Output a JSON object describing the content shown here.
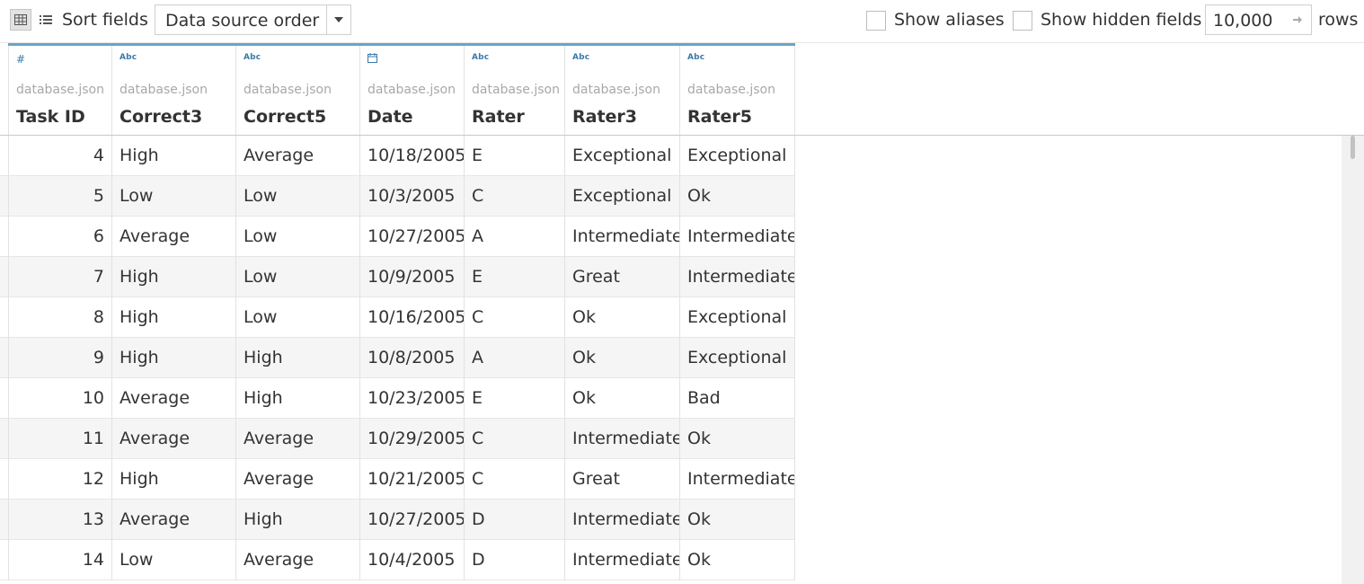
{
  "toolbar": {
    "sort_label": "Sort fields",
    "sort_value": "Data source order",
    "show_aliases_label": "Show aliases",
    "show_aliases_checked": false,
    "show_hidden_label": "Show hidden fields",
    "show_hidden_checked": false,
    "rows_value": "10,000",
    "rows_label": "rows",
    "grid_view_icon": "grid-icon",
    "list_view_icon": "list-icon"
  },
  "columns": [
    {
      "type_icon": "#",
      "type": "number",
      "source": "database.json",
      "name": "Task ID"
    },
    {
      "type_icon": "Abc",
      "type": "string",
      "source": "database.json",
      "name": "Correct3"
    },
    {
      "type_icon": "Abc",
      "type": "string",
      "source": "database.json",
      "name": "Correct5"
    },
    {
      "type_icon": "calendar",
      "type": "date",
      "source": "database.json",
      "name": "Date"
    },
    {
      "type_icon": "Abc",
      "type": "string",
      "source": "database.json",
      "name": "Rater"
    },
    {
      "type_icon": "Abc",
      "type": "string",
      "source": "database.json",
      "name": "Rater3"
    },
    {
      "type_icon": "Abc",
      "type": "string",
      "source": "database.json",
      "name": "Rater5"
    }
  ],
  "rows": [
    [
      "4",
      "High",
      "Average",
      "10/18/2005",
      "E",
      "Exceptional",
      "Exceptional"
    ],
    [
      "5",
      "Low",
      "Low",
      "10/3/2005",
      "C",
      "Exceptional",
      "Ok"
    ],
    [
      "6",
      "Average",
      "Low",
      "10/27/2005",
      "A",
      "Intermediate",
      "Intermediate"
    ],
    [
      "7",
      "High",
      "Low",
      "10/9/2005",
      "E",
      "Great",
      "Intermediate"
    ],
    [
      "8",
      "High",
      "Low",
      "10/16/2005",
      "C",
      "Ok",
      "Exceptional"
    ],
    [
      "9",
      "High",
      "High",
      "10/8/2005",
      "A",
      "Ok",
      "Exceptional"
    ],
    [
      "10",
      "Average",
      "High",
      "10/23/2005",
      "E",
      "Ok",
      "Bad"
    ],
    [
      "11",
      "Average",
      "Average",
      "10/29/2005",
      "C",
      "Intermediate",
      "Ok"
    ],
    [
      "12",
      "High",
      "Average",
      "10/21/2005",
      "C",
      "Great",
      "Intermediate"
    ],
    [
      "13",
      "Average",
      "High",
      "10/27/2005",
      "D",
      "Intermediate",
      "Ok"
    ],
    [
      "14",
      "Low",
      "Average",
      "10/4/2005",
      "D",
      "Intermediate",
      "Ok"
    ]
  ]
}
